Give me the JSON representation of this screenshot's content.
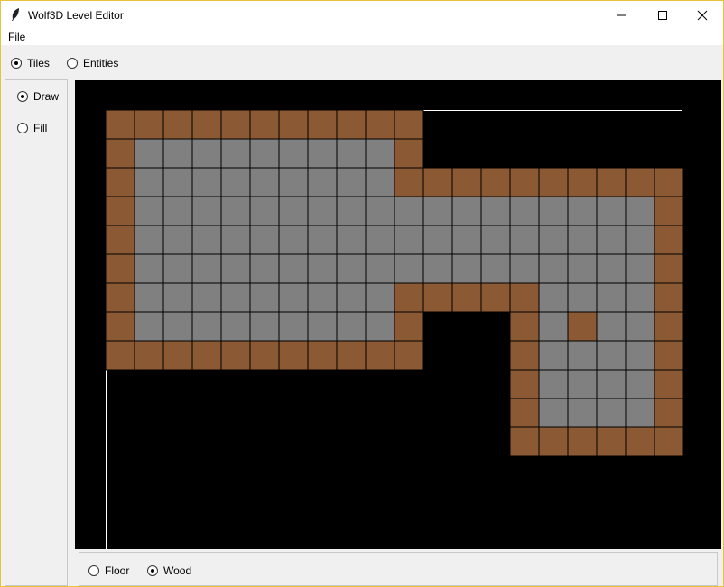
{
  "window": {
    "title": "Wolf3D Level Editor",
    "border_color": "#e8c23c"
  },
  "menubar": {
    "file_label": "File"
  },
  "mode": {
    "options": [
      {
        "label": "Tiles",
        "checked": true
      },
      {
        "label": "Entities",
        "checked": false
      }
    ]
  },
  "tool": {
    "options": [
      {
        "label": "Draw",
        "checked": true
      },
      {
        "label": "Fill",
        "checked": false
      }
    ]
  },
  "material": {
    "options": [
      {
        "label": "Floor",
        "checked": false
      },
      {
        "label": "Wood",
        "checked": true
      }
    ]
  },
  "map": {
    "colors": {
      "background": "#000000",
      "floor": "#808080",
      "wood": "#8b5a35",
      "boundary": "#ffffff"
    },
    "legend": {
      "W": "wood",
      "F": "floor",
      ".": "empty"
    },
    "rows": [
      "WWWWWWWWWRW..........",
      "WFFFFFFFFFW..........",
      "WFFFFFFFFFWWWWWWWWWW.",
      "WFFFFFFFFFFFFFFFFFFW.",
      "WFFFFFFFFFFFFFFFFFFW.",
      "WFFFFFFFFFFFFFFFFFFW.",
      "WFFFFFFFFFWWWWWFFFFW.",
      "WFFFFFFFFFW...WFWFFW.",
      "WWWWWWWWWWW...WFFFFW.",
      "..............WFFFFW.",
      "..............WFFFFW.",
      "..............WWWWWW."
    ]
  }
}
